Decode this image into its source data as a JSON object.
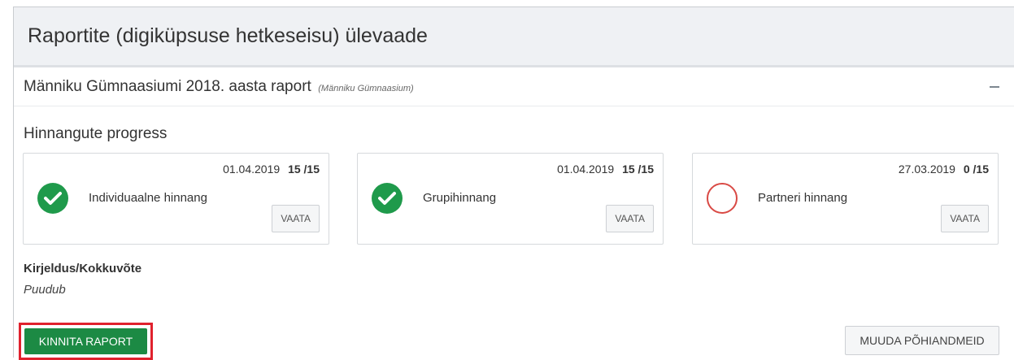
{
  "page": {
    "title": "Raportite (digiküpsuse hetkeseisu) ülevaade"
  },
  "report": {
    "title": "Männiku Gümnaasiumi 2018. aasta raport",
    "school": "(Männiku Gümnaasium)",
    "collapse_icon": "minus-icon"
  },
  "progress": {
    "section_title": "Hinnangute progress",
    "cards": [
      {
        "date": "01.04.2019",
        "count": "15 /15",
        "label": "Individuaalne hinnang",
        "status": "complete",
        "status_icon": "check-circle-icon",
        "button": "VAATA"
      },
      {
        "date": "01.04.2019",
        "count": "15 /15",
        "label": "Grupihinnang",
        "status": "complete",
        "status_icon": "check-circle-icon",
        "button": "VAATA"
      },
      {
        "date": "27.03.2019",
        "count": "0 /15",
        "label": "Partneri hinnang",
        "status": "empty",
        "status_icon": "empty-circle-icon",
        "button": "VAATA"
      }
    ]
  },
  "description": {
    "label": "Kirjeldus/Kokkuvõte",
    "value": "Puudub"
  },
  "actions": {
    "confirm_label": "KINNITA RAPORT",
    "edit_label": "MUUDA PÕHIANDMEID"
  },
  "colors": {
    "success": "#1f9a4b",
    "confirm_button": "#1c8a44",
    "empty_ring": "#d94a45",
    "highlight_border": "#e0212d"
  }
}
